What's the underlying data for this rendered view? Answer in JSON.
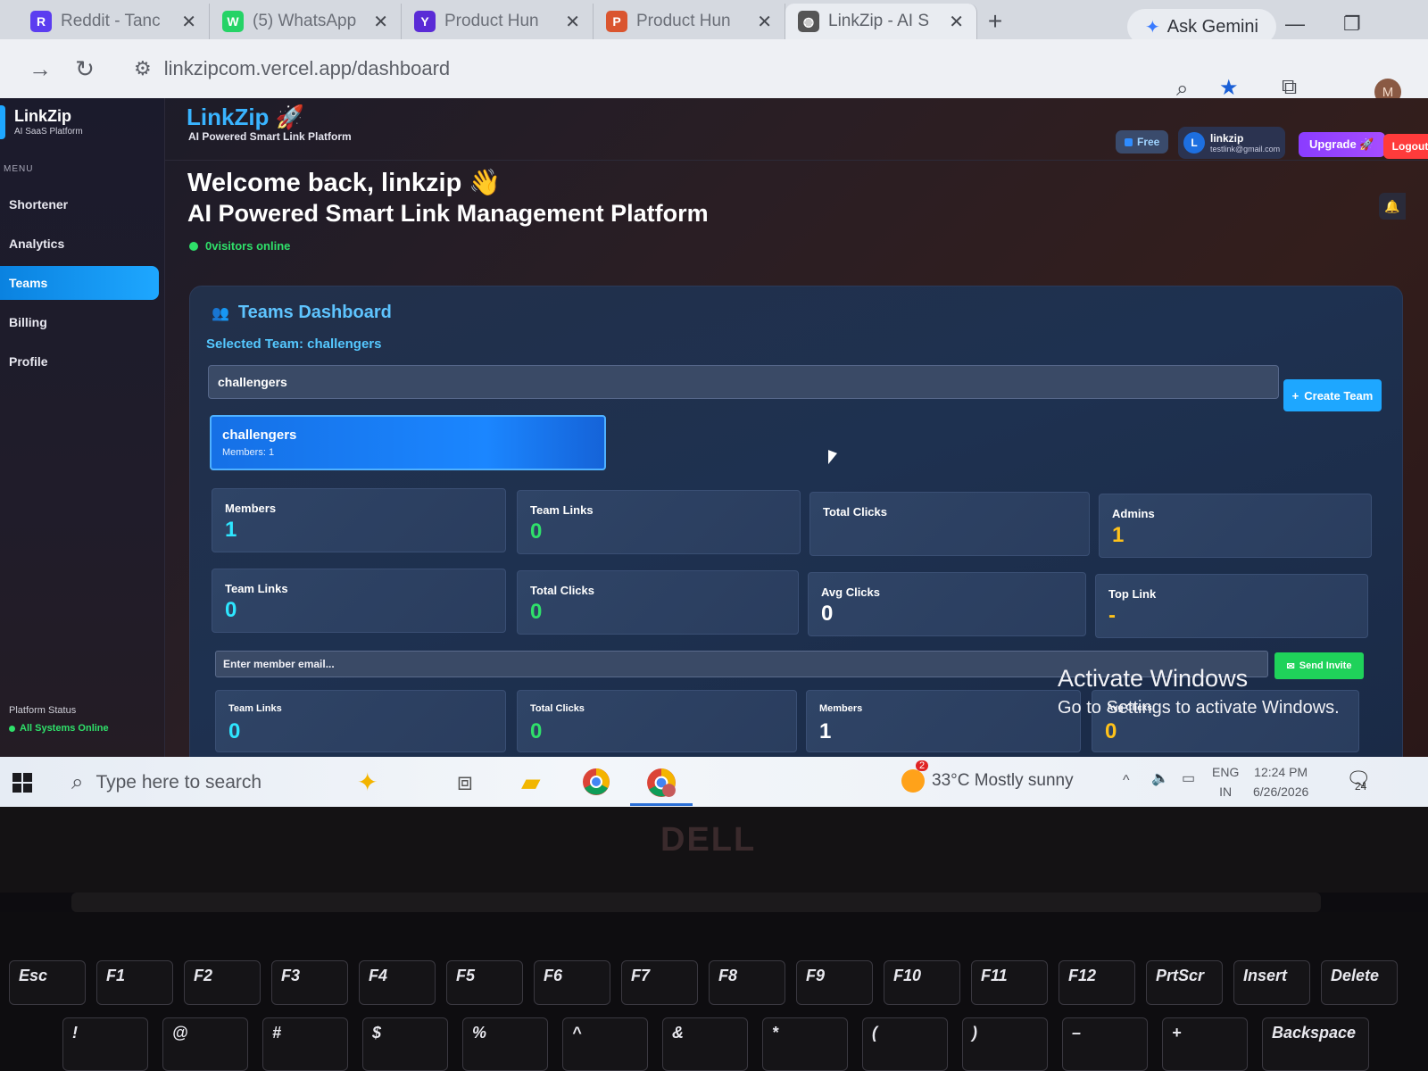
{
  "browser": {
    "tabs": [
      {
        "label": "Reddit - Tanc",
        "favicon": "R",
        "color": "#5b3df0"
      },
      {
        "label": "(5) WhatsApp",
        "favicon": "W",
        "color": "#25d366"
      },
      {
        "label": "Product Hun",
        "favicon": "Y",
        "color": "#5a2bd6"
      },
      {
        "label": "Product Hun",
        "favicon": "P",
        "color": "#da552f"
      },
      {
        "label": "LinkZip - AI S",
        "favicon": "globe",
        "color": "#555"
      }
    ],
    "ask_gemini": "Ask Gemini",
    "url": "linkzipcom.vercel.app/dashboard",
    "profile_initial": "M"
  },
  "sidebar": {
    "brand": "LinkZip",
    "brand_sub": "AI SaaS Platform",
    "menu_label": "MENU",
    "items": [
      {
        "label": "Shortener",
        "active": false
      },
      {
        "label": "Analytics",
        "active": false
      },
      {
        "label": "Teams",
        "active": true
      },
      {
        "label": "Billing",
        "active": false
      },
      {
        "label": "Profile",
        "active": false
      }
    ],
    "status_label": "Platform Status",
    "status_value": "All Systems Online"
  },
  "header": {
    "title": "LinkZip 🚀",
    "subtitle": "AI Powered Smart Link Platform",
    "plan": "Free",
    "user_initial": "L",
    "user_name": "linkzip",
    "user_email": "testlink@gmail.com",
    "upgrade": "Upgrade 🚀",
    "logout": "Logout"
  },
  "welcome": {
    "greeting": "Welcome back, linkzip 👋",
    "tagline": "AI Powered Smart Link Management Platform",
    "online": "0visitors online"
  },
  "teams": {
    "title": "Teams Dashboard",
    "selected": "Selected Team: challengers",
    "team_input_value": "challengers",
    "create_button": "Create Team",
    "team_card_name": "challengers",
    "team_card_members": "Members: 1",
    "stats_row1": [
      {
        "label": "Members",
        "value": "1",
        "color": "#2ee6ff"
      },
      {
        "label": "Team Links",
        "value": "0",
        "color": "#2fe06a"
      },
      {
        "label": "Total Clicks",
        "value": "",
        "color": "#ffffff"
      },
      {
        "label": "Admins",
        "value": "1",
        "color": "#ffc21a"
      }
    ],
    "stats_row2": [
      {
        "label": "Team Links",
        "value": "0",
        "color": "#2ee6ff"
      },
      {
        "label": "Total Clicks",
        "value": "0",
        "color": "#2fe06a"
      },
      {
        "label": "Avg Clicks",
        "value": "0",
        "color": "#ffffff"
      },
      {
        "label": "Top Link",
        "value": "-",
        "color": "#ffc21a"
      }
    ],
    "email_placeholder": "Enter member email...",
    "invite_button": "Send Invite",
    "stats_row3": [
      {
        "label": "Team Links",
        "value": "0",
        "color": "#2ee6ff"
      },
      {
        "label": "Total Clicks",
        "value": "0",
        "color": "#2fe06a"
      },
      {
        "label": "Members",
        "value": "1",
        "color": "#ffffff"
      },
      {
        "label": "Avg Clicks",
        "value": "0",
        "color": "#ffc21a"
      }
    ]
  },
  "watermark": {
    "title": "Activate Windows",
    "subtitle": "Go to Settings to activate Windows."
  },
  "taskbar": {
    "search_placeholder": "Type here to search",
    "weather_badge": "2",
    "weather": "33°C  Mostly sunny",
    "lang1": "ENG",
    "lang2": "IN",
    "time": "12:24 PM",
    "date": "6/26/2026",
    "notifications": "24"
  },
  "laptop": {
    "logo": "DELL",
    "fkeys": [
      "Esc",
      "F1",
      "F2",
      "F3",
      "F4",
      "F5",
      "F6",
      "F7",
      "F8",
      "F9",
      "F10",
      "F11",
      "F12",
      "PrtScr",
      "Insert",
      "Delete"
    ],
    "numkeys": [
      "!",
      "@",
      "#",
      "$",
      "%",
      "^",
      "&",
      "*",
      "(",
      ")",
      "–",
      "+",
      "Backspace"
    ]
  }
}
